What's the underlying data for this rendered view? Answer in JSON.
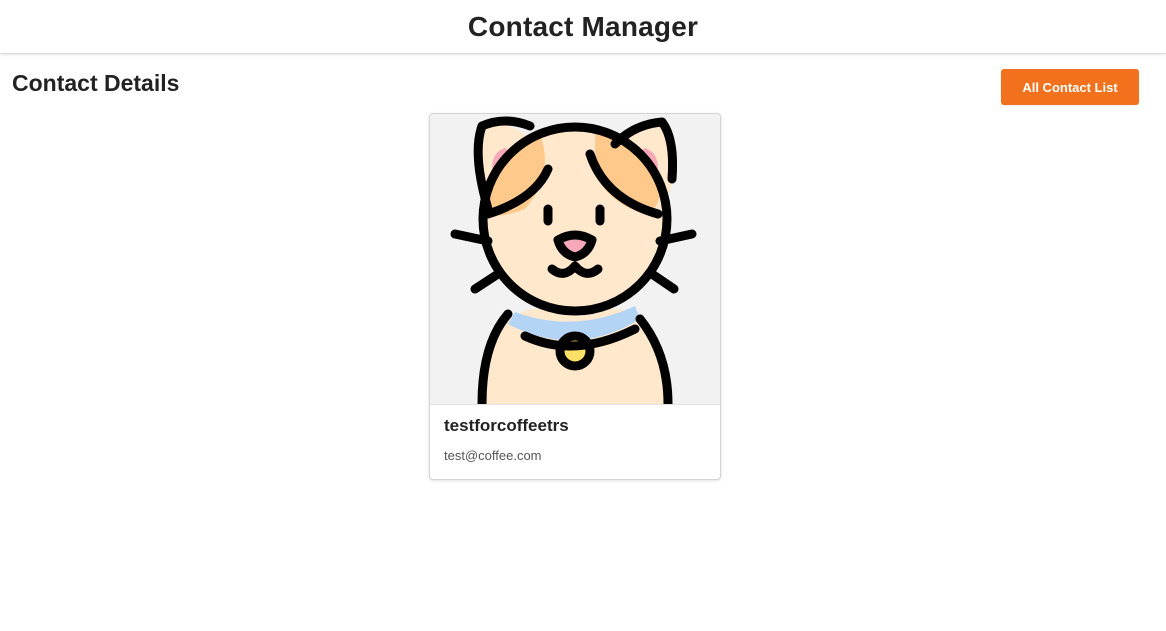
{
  "header": {
    "title": "Contact Manager"
  },
  "page": {
    "title": "Contact Details",
    "all_contacts_label": "All Contact List"
  },
  "contact": {
    "name": "testforcoffeetrs",
    "email": "test@coffee.com",
    "avatar_icon": "cat-avatar-icon"
  },
  "colors": {
    "accent": "#f2711c",
    "cat_fur": "#ffe8cc",
    "cat_patch": "#ffc98b",
    "cat_ear_inner": "#f7a8b8",
    "collar": "#b3d4f5",
    "bell": "#ffe066",
    "avatar_bg": "#f2f2f2"
  }
}
